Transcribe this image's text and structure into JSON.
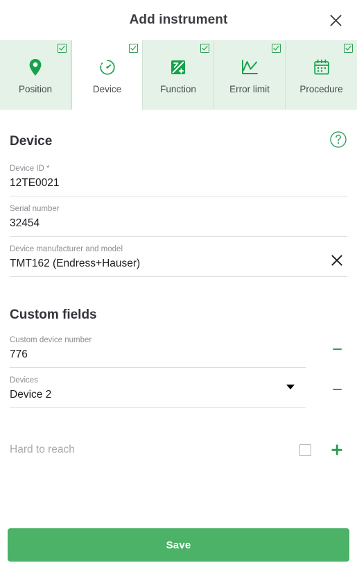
{
  "header": {
    "title": "Add instrument",
    "close_icon": "close-icon"
  },
  "tabs": [
    {
      "label": "Position",
      "icon": "map-pin-icon",
      "checked": true,
      "active": false
    },
    {
      "label": "Device",
      "icon": "gauge-icon",
      "checked": true,
      "active": true
    },
    {
      "label": "Function",
      "icon": "function-add-icon",
      "checked": true,
      "active": false
    },
    {
      "label": "Error limit",
      "icon": "line-chart-icon",
      "checked": true,
      "active": false
    },
    {
      "label": "Procedure",
      "icon": "calendar-icon",
      "checked": true,
      "active": false
    }
  ],
  "device_section": {
    "title": "Device",
    "help_icon": "help-circle-icon",
    "fields": [
      {
        "label": "Device ID *",
        "value": "12TE0021",
        "placeholder": "",
        "has_clear": false
      },
      {
        "label": "Serial number",
        "value": "32454",
        "placeholder": "",
        "has_clear": false
      },
      {
        "label": "Device manufacturer and model",
        "value": "TMT162 (Endress+Hauser)",
        "placeholder": "",
        "has_clear": true,
        "clear_icon": "close-icon"
      }
    ]
  },
  "custom_section": {
    "title": "Custom fields",
    "fields": [
      {
        "label": "Custom device number",
        "value": "776",
        "placeholder": "",
        "type": "text",
        "remove_icon": "minus-icon"
      },
      {
        "label": "Devices",
        "value": "Device 2",
        "placeholder": "",
        "type": "select",
        "caret_icon": "chevron-down-icon",
        "remove_icon": "minus-icon"
      }
    ],
    "add_row": {
      "label": "Hard to reach",
      "checkbox_checked": false,
      "add_icon": "plus-icon"
    }
  },
  "footer": {
    "save_label": "Save"
  },
  "colors": {
    "accent_green": "#2e9b54",
    "save_green": "#4cb268",
    "tab_bg": "#e4f2e7",
    "tab_active_bg": "#ffffff",
    "label_gray": "#8d8d94",
    "value_dark": "#1d1d22",
    "divider": "#dcdcdc"
  }
}
